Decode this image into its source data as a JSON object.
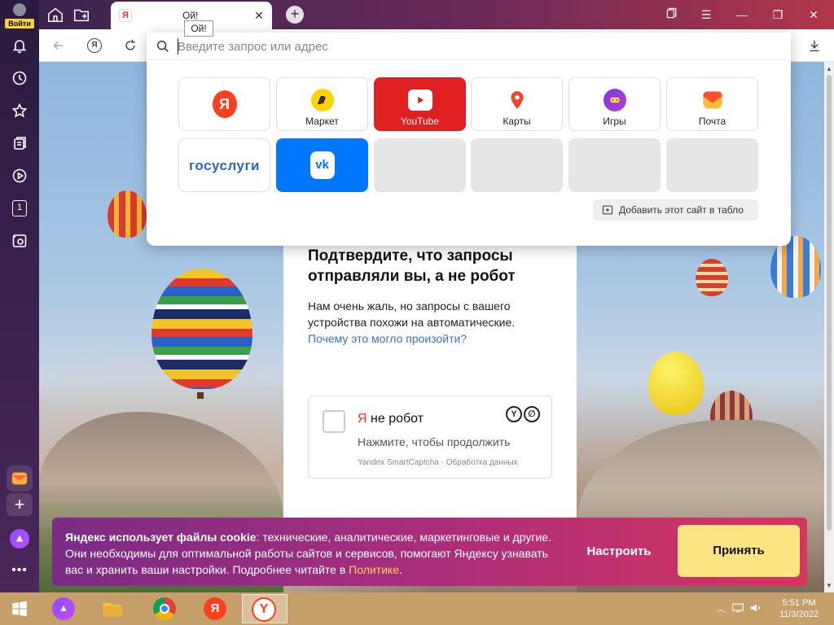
{
  "sidebar": {
    "login_label": "Войти",
    "tabs_count": "1"
  },
  "tabstrip": {
    "active_tab_title": "Ой!",
    "tooltip": "Ой!",
    "tab_favicon_letter": "Я"
  },
  "omnibox": {
    "placeholder": "Введите запрос или адрес",
    "tiles": [
      {
        "label": "",
        "icon": "yandex-icon"
      },
      {
        "label": "Маркет",
        "icon": "market-icon"
      },
      {
        "label": "YouTube",
        "icon": "youtube-icon"
      },
      {
        "label": "Карты",
        "icon": "maps-icon"
      },
      {
        "label": "Игры",
        "icon": "games-icon"
      },
      {
        "label": "Почта",
        "icon": "mail-icon"
      },
      {
        "label": "госуслуги",
        "icon": "gosuslugi-logo"
      },
      {
        "label": "",
        "icon": "vk-icon"
      }
    ],
    "add_site_label": "Добавить этот сайт в табло"
  },
  "captcha": {
    "title": "Подтвердите, что запросы отправляли вы, а не робот",
    "text": "Нам очень жаль, но запросы с вашего устройства похожи на автоматические.",
    "link": "Почему это могло произойти?",
    "checkbox_brand": "Я",
    "checkbox_label": "не робот",
    "checkbox_sub": "Нажмите, чтобы продолжить",
    "footer": "Yandex SmartCaptcha · Обработка данных"
  },
  "cookie": {
    "bold": "Яндекс использует файлы cookie",
    "text": ": технические, аналитические, маркетинговые и другие. Они необходимы для оптимальной работы сайтов и сервисов, помогают Яндексу узнавать вас и хранить ваши настройки. Подробнее читайте в ",
    "link": "Политике",
    "end": ".",
    "settings_label": "Настроить",
    "accept_label": "Принять"
  },
  "taskbar": {
    "time": "5:51 PM",
    "date": "11/3/2022"
  },
  "colors": {
    "accept_bg": "#fce482",
    "link": "#3b6fc7",
    "youtube_red": "#e02020",
    "vk_blue": "#0077ff"
  }
}
